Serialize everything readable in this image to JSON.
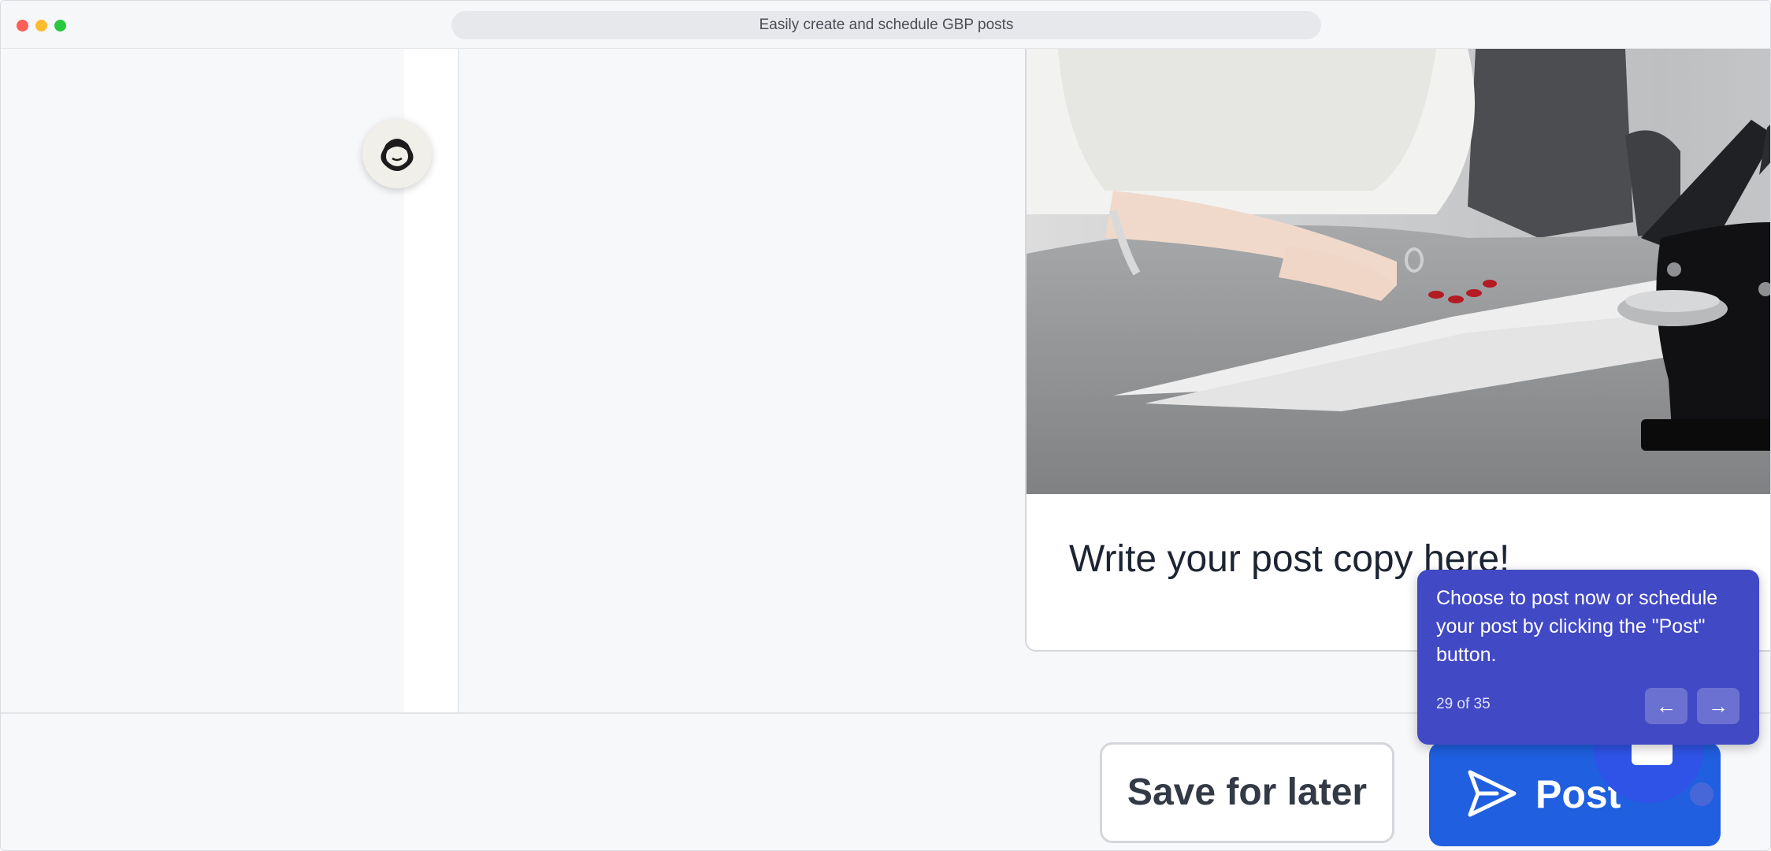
{
  "window": {
    "title": "Easily create and schedule GBP posts"
  },
  "post": {
    "image_alt": "Hand operating a black embossing seal press on a sheet of paper",
    "copy": "Write your post copy here!"
  },
  "footer": {
    "save_label": "Save for later",
    "post_label": "Post"
  },
  "tour": {
    "message": "Choose to post now or schedule your post by clicking the \"Post\" button.",
    "progress": "29 of 35",
    "prev_icon": "←",
    "next_icon": "→"
  },
  "colors": {
    "primary": "#1f5fe0",
    "tooltip": "#4149c5",
    "chat": "#2e53e6"
  }
}
